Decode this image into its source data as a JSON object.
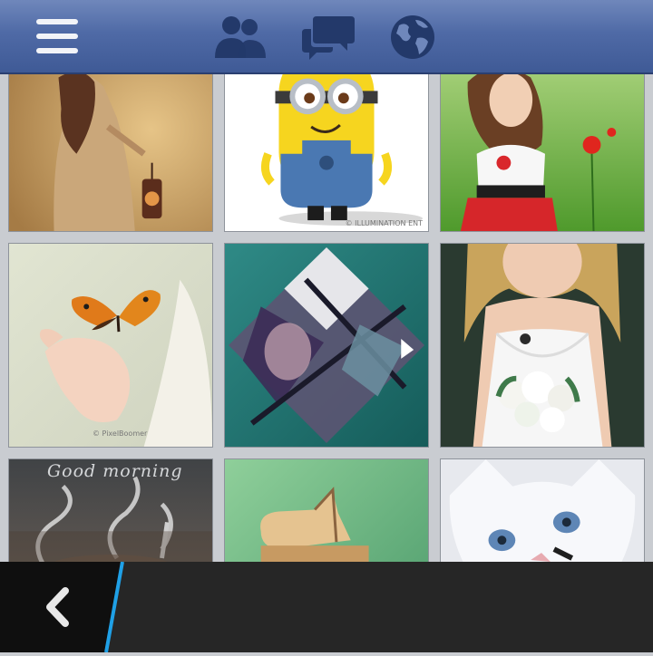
{
  "app": {
    "accent_color": "#4f6aa6",
    "bottom_accent_color": "#1fa0e6"
  },
  "top_bar": {
    "icons": [
      "hamburger-menu-icon",
      "friends-icon",
      "messages-icon",
      "globe-icon"
    ]
  },
  "photos": [
    {
      "id": "girl-with-lantern"
    },
    {
      "id": "minion",
      "watermark": "© ILLUMINATION ENT"
    },
    {
      "id": "girl-in-field"
    },
    {
      "id": "butterfly-on-hand",
      "watermark": "© PixelBoomer"
    },
    {
      "id": "abstract-diamond-portrait"
    },
    {
      "id": "bride-with-bouquet"
    },
    {
      "id": "good-morning-steam",
      "text": "Good morning"
    },
    {
      "id": "wooden-piano"
    },
    {
      "id": "white-kitten"
    }
  ],
  "bottom_bar": {
    "icons": [
      "back-chevron-icon"
    ]
  }
}
